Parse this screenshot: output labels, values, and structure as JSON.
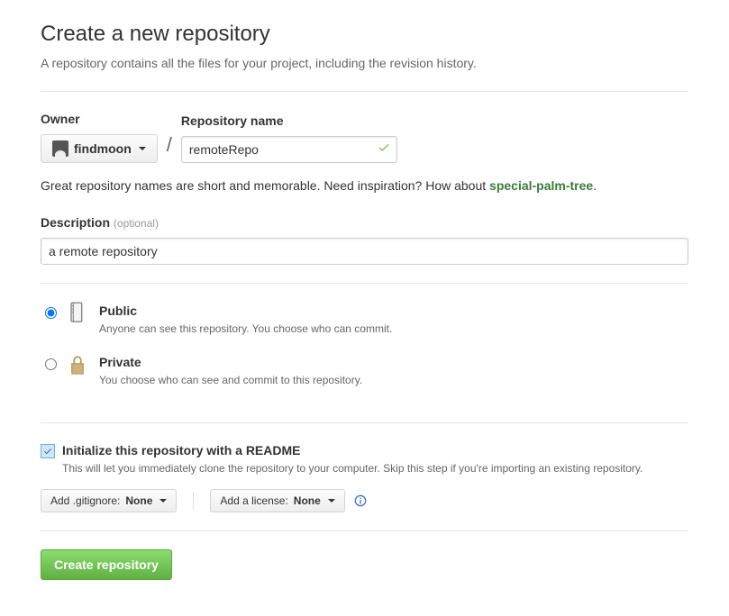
{
  "header": {
    "title": "Create a new repository",
    "subtitle": "A repository contains all the files for your project, including the revision history."
  },
  "owner": {
    "label": "Owner",
    "username": "findmoon"
  },
  "repo_name": {
    "label": "Repository name",
    "value": "remoteRepo"
  },
  "hint": {
    "prefix": "Great repository names are short and memorable. Need inspiration? How about ",
    "suggestion": "special-palm-tree",
    "suffix": "."
  },
  "description": {
    "label": "Description",
    "optional": "(optional)",
    "value": "a remote repository"
  },
  "visibility": {
    "public": {
      "label": "Public",
      "desc": "Anyone can see this repository. You choose who can commit."
    },
    "private": {
      "label": "Private",
      "desc": "You choose who can see and commit to this repository."
    }
  },
  "readme": {
    "label": "Initialize this repository with a README",
    "desc": "This will let you immediately clone the repository to your computer. Skip this step if you're importing an existing repository."
  },
  "buttons": {
    "gitignore_prefix": "Add .gitignore: ",
    "gitignore_value": "None",
    "license_prefix": "Add a license: ",
    "license_value": "None",
    "create": "Create repository"
  }
}
